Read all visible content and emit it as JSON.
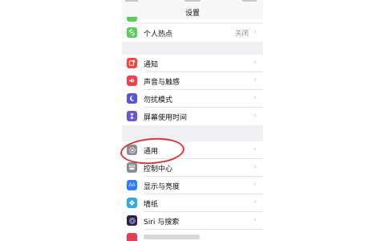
{
  "nav": {
    "title": "设置"
  },
  "rows": {
    "hotspot": {
      "label": "个人热点",
      "value": "关闭"
    },
    "notifications": {
      "label": "通知"
    },
    "sounds": {
      "label": "声音与触感"
    },
    "dnd": {
      "label": "勿扰模式"
    },
    "screen_time": {
      "label": "屏幕使用时间"
    },
    "general": {
      "label": "通用"
    },
    "control_center": {
      "label": "控制中心"
    },
    "display": {
      "label": "显示与亮度",
      "icon_text": "AA"
    },
    "wallpaper": {
      "label": "墙纸"
    },
    "siri": {
      "label": "Siri 与搜索"
    }
  },
  "colors": {
    "hotspot": "#5ecb5c",
    "notifications": "#f2473f",
    "sounds": "#f2424b",
    "dnd": "#5856d6",
    "screen_time": "#6a59d2",
    "general": "#8e8e93",
    "control_center": "#8e8e93",
    "display": "#2f7cf6",
    "wallpaper": "#35aadc",
    "siri": "#26263a",
    "annotation": "#d43a3a"
  },
  "icons": {
    "hotspot": "hotspot-link-icon",
    "notifications": "notification-bell-icon",
    "sounds": "speaker-icon",
    "dnd": "moon-icon",
    "screen_time": "hourglass-icon",
    "general": "gear-icon",
    "control_center": "toggles-icon",
    "display": "display-aa-icon",
    "wallpaper": "flower-icon",
    "siri": "siri-icon"
  }
}
